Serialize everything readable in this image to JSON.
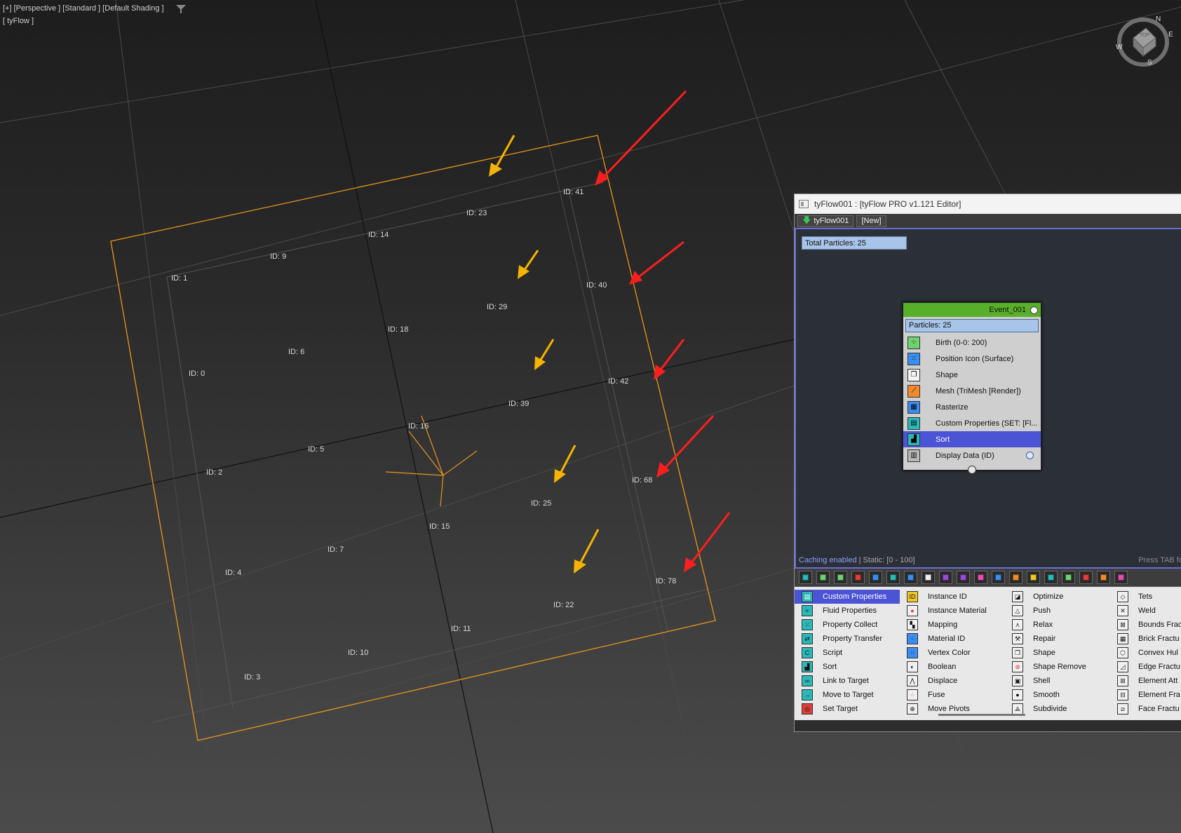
{
  "viewport": {
    "label": "[+] [Perspective ] [Standard ] [Default Shading ]",
    "object_label": "[ tyFlow ]",
    "filter_icon": "funnel-icon",
    "viewcube": {
      "top_label": "TOP",
      "n": "N",
      "e": "E",
      "s": "S",
      "w": "W"
    },
    "particles": [
      {
        "id": "ID: 41"
      },
      {
        "id": "ID: 23"
      },
      {
        "id": "ID: 14"
      },
      {
        "id": "ID: 9"
      },
      {
        "id": "ID: 1"
      },
      {
        "id": "ID: 40"
      },
      {
        "id": "ID: 29"
      },
      {
        "id": "ID: 18"
      },
      {
        "id": "ID: 6"
      },
      {
        "id": "ID: 0"
      },
      {
        "id": "ID: 42"
      },
      {
        "id": "ID: 39"
      },
      {
        "id": "ID: 16"
      },
      {
        "id": "ID: 5"
      },
      {
        "id": "ID: 2"
      },
      {
        "id": "ID: 68"
      },
      {
        "id": "ID: 25"
      },
      {
        "id": "ID: 15"
      },
      {
        "id": "ID: 7"
      },
      {
        "id": "ID: 4"
      },
      {
        "id": "ID: 78"
      },
      {
        "id": "ID: 22"
      },
      {
        "id": "ID: 11"
      },
      {
        "id": "ID: 10"
      },
      {
        "id": "ID: 3"
      }
    ],
    "arrow_colors": {
      "yellow": "#f5b400",
      "red": "#ff1e1e"
    },
    "accent": "#e8961c"
  },
  "editor": {
    "title": "tyFlow001 : [tyFlow PRO v1.121 Editor]",
    "tabs": [
      {
        "label": "tyFlow001",
        "icon": "download-arrow-icon"
      },
      {
        "label": "[New]"
      }
    ],
    "total_particles": "Total Particles: 25",
    "event": {
      "name": "Event_001",
      "particles": "Particles: 25",
      "operators": [
        {
          "label": "Birth (0-0: 200)",
          "icon": "birth-icon"
        },
        {
          "label": "Position Icon (Surface)",
          "icon": "position-icon"
        },
        {
          "label": "Shape",
          "icon": "shape-icon"
        },
        {
          "label": "Mesh (TriMesh [Render])",
          "icon": "mesh-icon"
        },
        {
          "label": "Rasterize",
          "icon": "rasterize-icon"
        },
        {
          "label": "Custom Properties (SET: [Fl...",
          "icon": "custom-properties-icon"
        },
        {
          "label": "Sort",
          "icon": "sort-icon",
          "selected": true
        },
        {
          "label": "Display Data (ID)",
          "icon": "display-data-icon"
        }
      ]
    },
    "status_cache": "Caching enabled",
    "status_static": " | Static: [0 - 100]",
    "hint": "Press TAB fo",
    "palette": {
      "col1": [
        "Custom Properties",
        "Fluid Properties",
        "Property Collect",
        "Property Transfer",
        "Script",
        "Sort",
        "Link to Target",
        "Move to Target",
        "Set Target"
      ],
      "col2": [
        "Instance ID",
        "Instance Material",
        "Mapping",
        "Material ID",
        "Vertex Color",
        "Boolean",
        "Displace",
        "Fuse",
        "Move Pivots"
      ],
      "col3": [
        "Optimize",
        "Push",
        "Relax",
        "Repair",
        "Shape",
        "Shape Remove",
        "Shell",
        "Smooth",
        "Subdivide"
      ],
      "col4": [
        "Tets",
        "Weld",
        "Bounds Frac",
        "Brick Fractu",
        "Convex Hul",
        "Edge Fractu",
        "Element Att",
        "Element Fra",
        "Face Fractu"
      ]
    }
  }
}
